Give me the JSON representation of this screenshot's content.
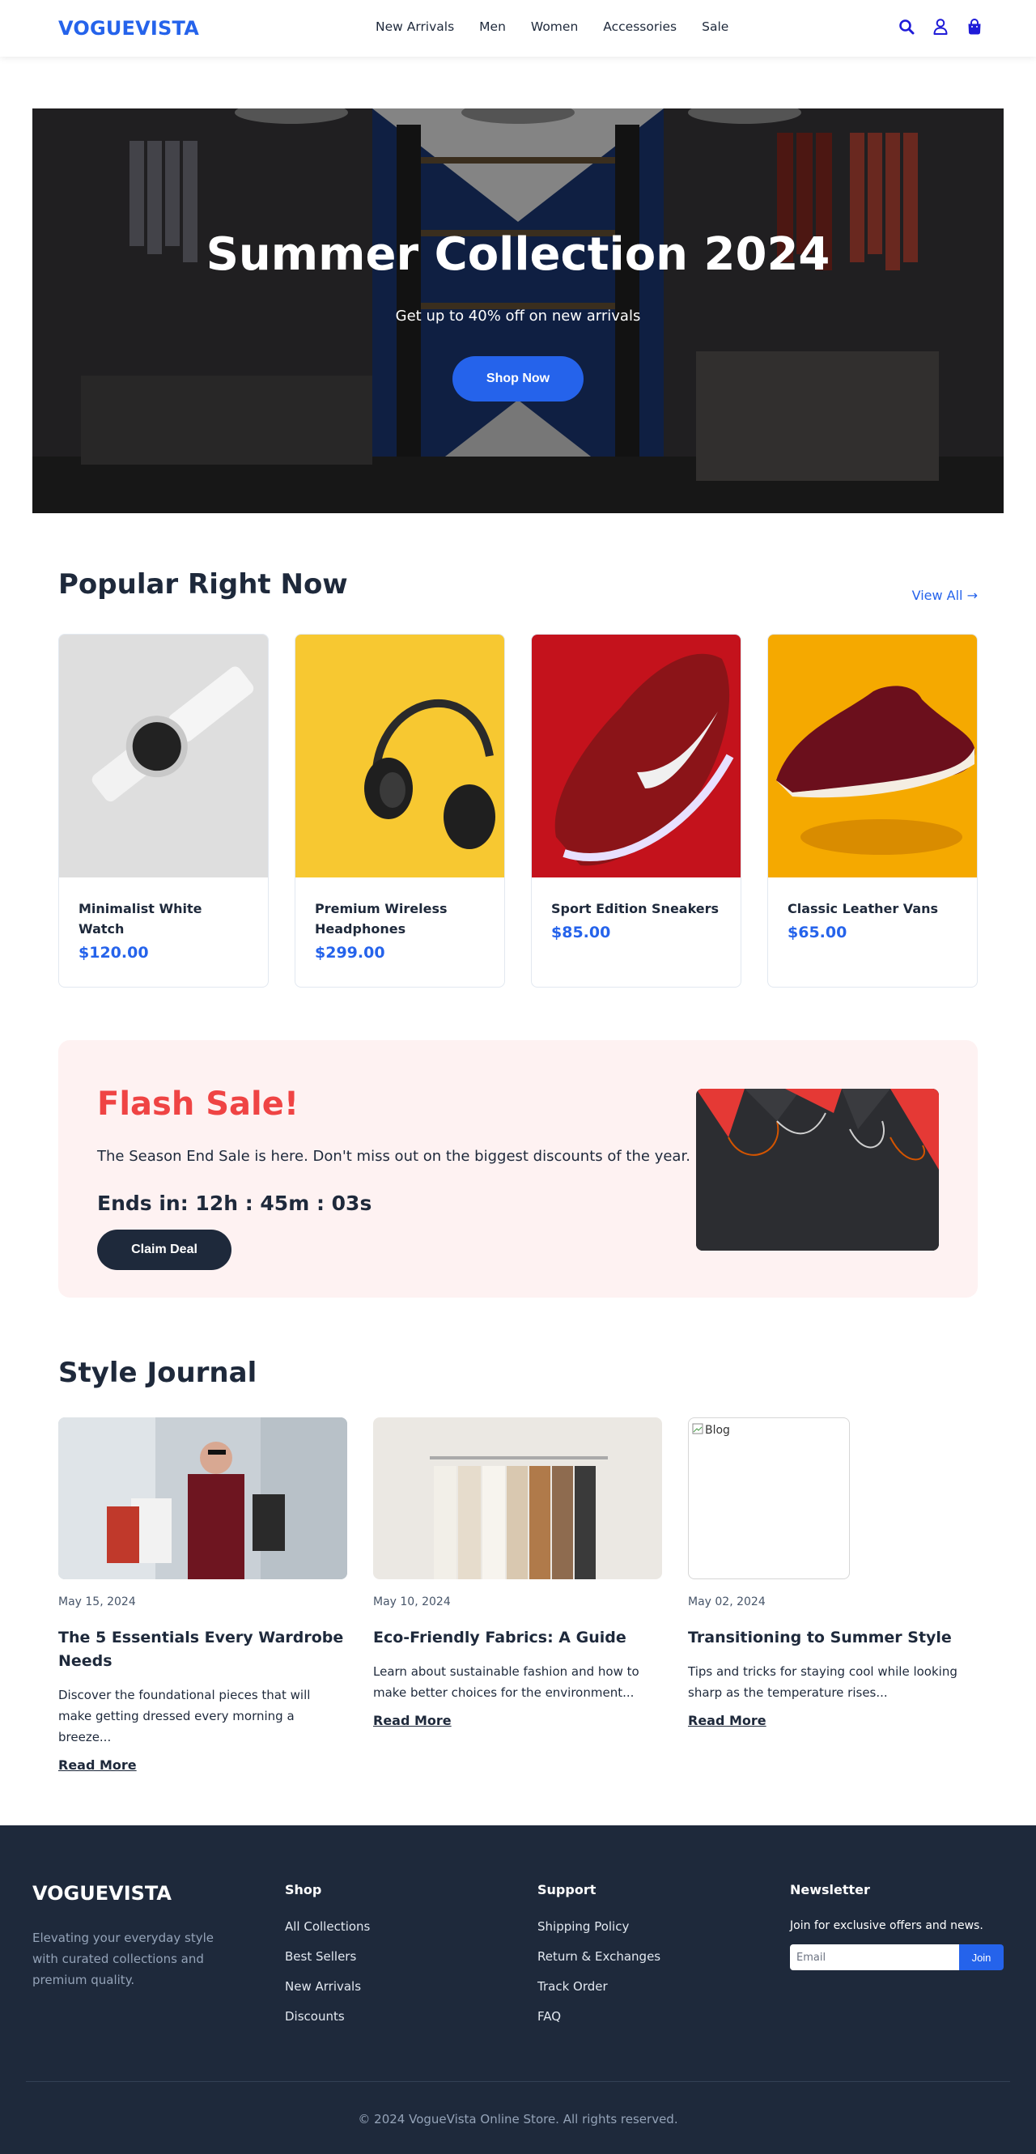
{
  "header": {
    "logo": "VOGUEVISTA",
    "nav": [
      "New Arrivals",
      "Men",
      "Women",
      "Accessories",
      "Sale"
    ],
    "icons": [
      "search-icon",
      "user-icon",
      "shopping-bag-icon"
    ],
    "accent_color": "#2563eb"
  },
  "hero": {
    "title": "Summer Collection 2024",
    "subtitle": "Get up to 40% off on new arrivals",
    "cta": "Shop Now",
    "image": "clothing-store-interior-photo"
  },
  "popular": {
    "title": "Popular Right Now",
    "view_all": "View All →",
    "products": [
      {
        "name": "Minimalist White Watch",
        "price": "$120.00",
        "image": "white-watch-photo"
      },
      {
        "name": "Premium Wireless Headphones",
        "price": "$299.00",
        "image": "headphones-photo"
      },
      {
        "name": "Sport Edition Sneakers",
        "price": "$85.00",
        "image": "red-sneaker-photo"
      },
      {
        "name": "Classic Leather Vans",
        "price": "$65.00",
        "image": "maroon-vans-photo"
      }
    ]
  },
  "flash": {
    "title": "Flash Sale!",
    "text": "The Season End Sale is here. Don't miss out on the biggest discounts of the year.",
    "timer": "Ends in: 12h : 45m : 03s",
    "cta": "Claim Deal",
    "image": "shopping-bags-photo",
    "title_color": "#ef4444"
  },
  "journal": {
    "title": "Style Journal",
    "posts": [
      {
        "date": "May 15, 2024",
        "title": "The 5 Essentials Every Wardrobe Needs",
        "excerpt": "Discover the foundational pieces that will make getting dressed every morning a breeze...",
        "link": "Read More",
        "image": "woman-shopping-bags-photo"
      },
      {
        "date": "May 10, 2024",
        "title": "Eco-Friendly Fabrics: A Guide",
        "excerpt": "Learn about sustainable fashion and how to make better choices for the environment...",
        "link": "Read More",
        "image": "clothes-rack-photo"
      },
      {
        "date": "May 02, 2024",
        "title": "Transitioning to Summer Style",
        "excerpt": "Tips and tricks for staying cool while looking sharp as the temperature rises...",
        "link": "Read More",
        "image_alt": "Blog"
      }
    ]
  },
  "footer": {
    "logo": "VOGUEVISTA",
    "description": "Elevating your everyday style with curated collections and premium quality.",
    "shop": {
      "title": "Shop",
      "links": [
        "All Collections",
        "Best Sellers",
        "New Arrivals",
        "Discounts"
      ]
    },
    "support": {
      "title": "Support",
      "links": [
        "Shipping Policy",
        "Return & Exchanges",
        "Track Order",
        "FAQ"
      ]
    },
    "newsletter": {
      "title": "Newsletter",
      "text": "Join for exclusive offers and news.",
      "placeholder": "Email",
      "button": "Join"
    },
    "copyright": "© 2024 VogueVista Online Store. All rights reserved."
  }
}
